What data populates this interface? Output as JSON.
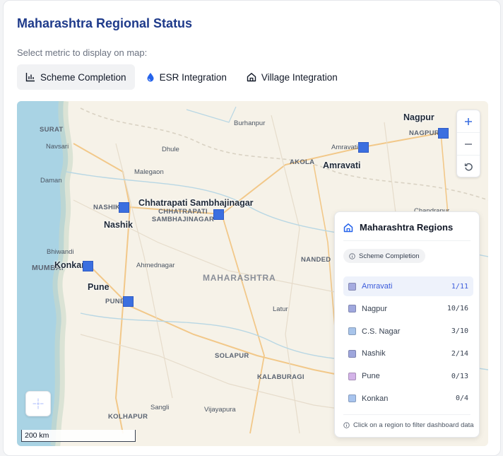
{
  "header": {
    "title": "Maharashtra Regional Status",
    "subtitle": "Select metric to display on map:"
  },
  "tabs": [
    {
      "label": "Scheme Completion",
      "icon": "bar-chart-icon",
      "active": true
    },
    {
      "label": "ESR Integration",
      "icon": "water-drop-icon",
      "active": false
    },
    {
      "label": "Village Integration",
      "icon": "home-icon",
      "active": false
    }
  ],
  "map": {
    "state_label": "MAHARASHTRA",
    "scale_label": "200 km",
    "cities": [
      {
        "label": "Burhanpur"
      },
      {
        "label": "SURAT"
      },
      {
        "label": "Navsari"
      },
      {
        "label": "Dhule"
      },
      {
        "label": "Malegaon"
      },
      {
        "label": "Daman"
      },
      {
        "label": "AKOLA"
      },
      {
        "label": "Amravati"
      },
      {
        "label": "NAGPUR"
      },
      {
        "label": "Chandrapur"
      },
      {
        "label": "NASHIK"
      },
      {
        "label": "CHHATRAPATI SAMBHAJINAGAR"
      },
      {
        "label": "Bhiwandi"
      },
      {
        "label": "MUMBAI"
      },
      {
        "label": "Ahmednagar"
      },
      {
        "label": "NANDED"
      },
      {
        "label": "PUNE"
      },
      {
        "label": "Latur"
      },
      {
        "label": "SOLAPUR"
      },
      {
        "label": "KALABURAGI"
      },
      {
        "label": "Sangli"
      },
      {
        "label": "Vijayapura"
      },
      {
        "label": "KOLHAPUR"
      }
    ],
    "region_labels": [
      "Nagpur",
      "Amravati",
      "Chhatrapati Sambhajinagar",
      "Nashik",
      "Konkan",
      "Pune"
    ]
  },
  "panel": {
    "title": "Maharashtra Regions",
    "chip": "Scheme Completion",
    "regions": [
      {
        "name": "Amravati",
        "count": "1/11",
        "color": "#a5abe0",
        "selected": true
      },
      {
        "name": "Nagpur",
        "count": "10/16",
        "color": "#a0a8de",
        "selected": false
      },
      {
        "name": "C.S. Nagar",
        "count": "3/10",
        "color": "#a8c4ea",
        "selected": false
      },
      {
        "name": "Nashik",
        "count": "2/14",
        "color": "#9ea6dc",
        "selected": false
      },
      {
        "name": "Pune",
        "count": "0/13",
        "color": "#d3b3e8",
        "selected": false
      },
      {
        "name": "Konkan",
        "count": "0/4",
        "color": "#a8c4ee",
        "selected": false
      }
    ],
    "footer": "Click on a region to filter dashboard data"
  },
  "colors": {
    "marker": "#3b6fe0",
    "title": "#1e3a8a",
    "accent": "#3b5bdb"
  }
}
